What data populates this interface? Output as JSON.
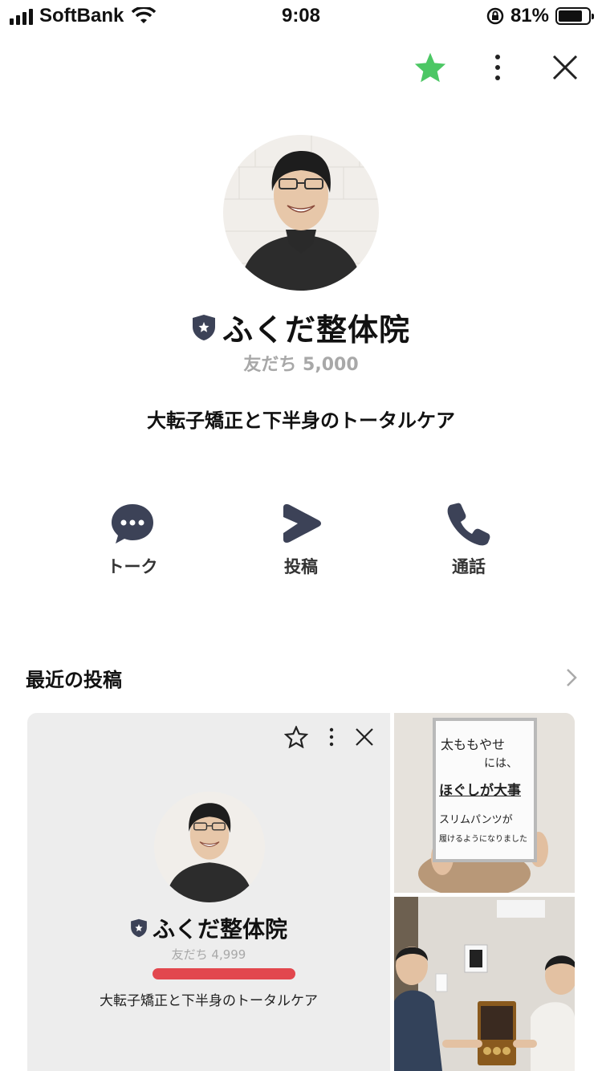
{
  "status_bar": {
    "carrier": "SoftBank",
    "time": "9:08",
    "battery": "81%",
    "battery_level": 0.81
  },
  "profile": {
    "name": "ふくだ整体院",
    "friends": "友だち 5,000",
    "description": "大転子矯正と下半身のトータルケア"
  },
  "actions": [
    {
      "label": "トーク",
      "icon": "chat-bubble-icon"
    },
    {
      "label": "投稿",
      "icon": "voom-post-icon"
    },
    {
      "label": "通話",
      "icon": "phone-icon"
    }
  ],
  "recent_posts": {
    "title": "最近の投稿",
    "mini_profile": {
      "name": "ふくだ整体院",
      "friends": "友だち 4,999",
      "description": "大転子矯正と下半身のトータルケア"
    },
    "whiteboard_lines": [
      "太ももやせ",
      "には、",
      "ほぐしが大事",
      "スリムパンツが",
      "履けるようになりました"
    ]
  },
  "colors": {
    "favorite_star": "#4cc764",
    "badge": "#3c4257",
    "redline": "#e2474e"
  }
}
